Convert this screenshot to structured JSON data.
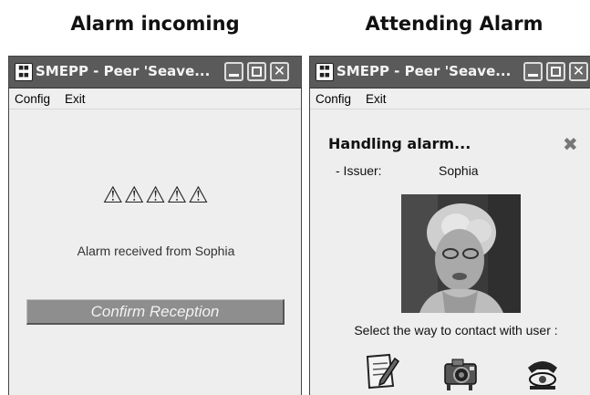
{
  "captions": {
    "left": "Alarm incoming",
    "right": "Attending Alarm"
  },
  "windows": {
    "left": {
      "title": "SMEPP - Peer 'Seave...",
      "menu": [
        "Config",
        "Exit"
      ],
      "warning_icons": "⚠⚠⚠⚠⚠",
      "alarm_text": "Alarm received from Sophia",
      "confirm_button": "Confirm Reception"
    },
    "right": {
      "title": "SMEPP - Peer 'Seave...",
      "menu": [
        "Config",
        "Exit"
      ],
      "heading": "Handling alarm...",
      "issuer_label": "- Issuer:",
      "issuer_value": "Sophia",
      "contact_prompt": "Select the way to contact with user :"
    }
  },
  "icons": {
    "app": "smepp-app-icon",
    "minimize": "minimize-icon",
    "maximize": "maximize-icon",
    "close": "close-icon",
    "warning": "warning-icon",
    "dismiss": "close-x-icon",
    "contact_options": [
      "note-edit-icon",
      "camera-icon",
      "telephone-icon"
    ]
  },
  "colors": {
    "titlebar": "#5a5a5a",
    "window_bg": "#eeeeee",
    "button_bg": "#8e8e8e"
  }
}
